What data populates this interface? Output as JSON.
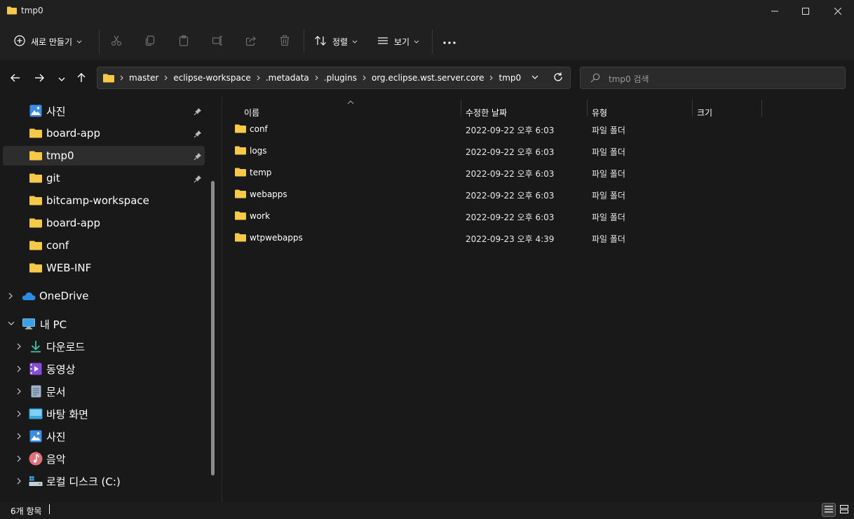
{
  "window": {
    "title": "tmp0"
  },
  "toolbar": {
    "new_label": "새로 만들기",
    "sort_label": "정렬",
    "view_label": "보기"
  },
  "address": {
    "crumbs": [
      "master",
      "eclipse-workspace",
      ".metadata",
      ".plugins",
      "org.eclipse.wst.server.core",
      "tmp0"
    ]
  },
  "search": {
    "placeholder": "tmp0 검색"
  },
  "sidebar": {
    "quick": [
      {
        "label": "사진"
      },
      {
        "label": "board-app"
      },
      {
        "label": "tmp0"
      },
      {
        "label": "git"
      },
      {
        "label": "bitcamp-workspace"
      },
      {
        "label": "board-app"
      },
      {
        "label": "conf"
      },
      {
        "label": "WEB-INF"
      }
    ],
    "onedrive": "OneDrive",
    "thispc": "내 PC",
    "pc_items": [
      {
        "label": "다운로드"
      },
      {
        "label": "동영상"
      },
      {
        "label": "문서"
      },
      {
        "label": "바탕 화면"
      },
      {
        "label": "사진"
      },
      {
        "label": "음악"
      },
      {
        "label": "로컬 디스크 (C:)"
      }
    ]
  },
  "columns": {
    "name": "이름",
    "date": "수정한 날짜",
    "type": "유형",
    "size": "크기"
  },
  "files": [
    {
      "name": "conf",
      "date": "2022-09-22 오후 6:03",
      "type": "파일 폴더"
    },
    {
      "name": "logs",
      "date": "2022-09-22 오후 6:03",
      "type": "파일 폴더"
    },
    {
      "name": "temp",
      "date": "2022-09-22 오후 6:03",
      "type": "파일 폴더"
    },
    {
      "name": "webapps",
      "date": "2022-09-22 오후 6:03",
      "type": "파일 폴더"
    },
    {
      "name": "work",
      "date": "2022-09-22 오후 6:03",
      "type": "파일 폴더"
    },
    {
      "name": "wtpwebapps",
      "date": "2022-09-23 오후 4:39",
      "type": "파일 폴더"
    }
  ],
  "status": {
    "count": "6개 항목"
  },
  "colors": {
    "background": "#191919",
    "folder": "#f7c948",
    "selected": "#2d2d2d"
  }
}
